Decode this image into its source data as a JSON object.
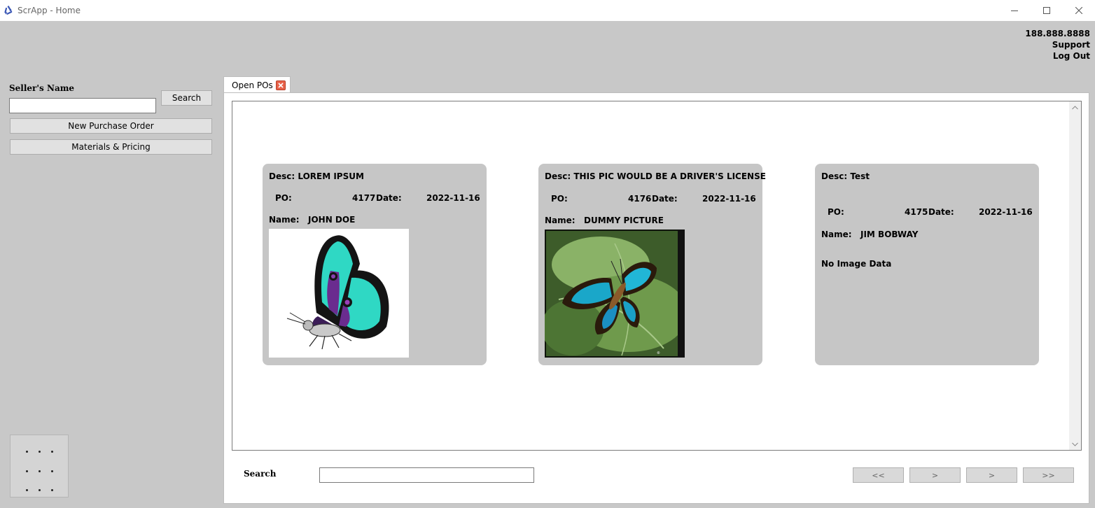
{
  "window": {
    "title": "ScrApp - Home",
    "icons": {
      "app": "recycle-icon",
      "minimize": "minimize-icon",
      "maximize": "maximize-icon",
      "close": "close-icon"
    }
  },
  "header": {
    "phone": "188.888.8888",
    "support": "Support",
    "logout": "Log Out"
  },
  "sidebar": {
    "seller_label": "Seller's Name",
    "seller_value": "",
    "search_button": "Search",
    "new_po_button": "New Purchase Order",
    "materials_button": "Materials & Pricing"
  },
  "tabs": [
    {
      "label": "Open POs",
      "close_icon": "close-icon"
    }
  ],
  "cards": [
    {
      "desc_label": "Desc:",
      "desc": "LOREM IPSUM",
      "po_label": "PO:",
      "po": "4177",
      "date_label": "Date:",
      "date": "2022-11-16",
      "name_label": "Name:",
      "name": "JOHN DOE",
      "image": "butterfly-drawing"
    },
    {
      "desc_label": "Desc:",
      "desc": "THIS PIC WOULD BE A DRIVER'S LICENSE",
      "po_label": "PO:",
      "po": "4176",
      "date_label": "Date:",
      "date": "2022-11-16",
      "name_label": "Name:",
      "name": "DUMMY PICTURE",
      "image": "butterfly-photo"
    },
    {
      "desc_label": "Desc:",
      "desc": "Test",
      "po_label": "PO:",
      "po": "4175",
      "date_label": "Date:",
      "date": "2022-11-16",
      "name_label": "Name:",
      "name": "JIM BOBWAY",
      "no_image": "No Image Data"
    }
  ],
  "footer": {
    "search_label": "Search",
    "search_value": "",
    "pager": {
      "first": "<<",
      "prev": ">",
      "next": ">",
      "last": ">>"
    }
  },
  "colors": {
    "panel_bg": "#c8c8c8",
    "card_bg": "#c6c6c6",
    "tab_close": "#e8624a"
  }
}
